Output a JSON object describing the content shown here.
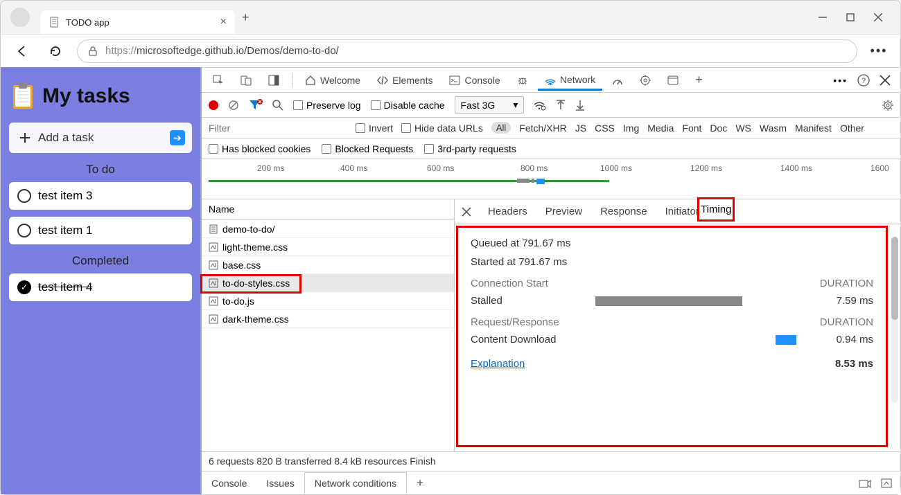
{
  "browser": {
    "tab_title": "TODO app",
    "url_proto": "https://",
    "url_rest": "microsoftedge.github.io/Demos/demo-to-do/"
  },
  "app": {
    "title": "My tasks",
    "add_label": "Add a task",
    "todo_label": "To do",
    "completed_label": "Completed",
    "todo_items": [
      "test item 3",
      "test item 1"
    ],
    "completed_items": [
      "test item 4"
    ]
  },
  "devtools": {
    "tabs": {
      "welcome": "Welcome",
      "elements": "Elements",
      "console": "Console",
      "network": "Network"
    },
    "toolbar": {
      "preserve_log": "Preserve log",
      "disable_cache": "Disable cache",
      "throttle": "Fast 3G"
    },
    "filter": {
      "placeholder": "Filter",
      "invert": "Invert",
      "hide_urls": "Hide data URLs",
      "types": [
        "All",
        "Fetch/XHR",
        "JS",
        "CSS",
        "Img",
        "Media",
        "Font",
        "Doc",
        "WS",
        "Wasm",
        "Manifest",
        "Other"
      ],
      "blocked_cookies": "Has blocked cookies",
      "blocked_requests": "Blocked Requests",
      "third_party": "3rd-party requests"
    },
    "timeline_ticks": [
      "200 ms",
      "400 ms",
      "600 ms",
      "800 ms",
      "1000 ms",
      "1200 ms",
      "1400 ms",
      "1600"
    ],
    "requests": {
      "header": "Name",
      "rows": [
        {
          "name": "demo-to-do/",
          "type": "doc"
        },
        {
          "name": "light-theme.css",
          "type": "css"
        },
        {
          "name": "base.css",
          "type": "css"
        },
        {
          "name": "to-do-styles.css",
          "type": "css",
          "selected": true
        },
        {
          "name": "to-do.js",
          "type": "css"
        },
        {
          "name": "dark-theme.css",
          "type": "css"
        }
      ]
    },
    "detail_tabs": [
      "Headers",
      "Preview",
      "Response",
      "Initiator",
      "Timing"
    ],
    "timing": {
      "queued": "Queued at 791.67 ms",
      "started": "Started at 791.67 ms",
      "conn_start": "Connection Start",
      "duration": "DURATION",
      "stalled": "Stalled",
      "stalled_val": "7.59 ms",
      "req_resp": "Request/Response",
      "content_dl": "Content Download",
      "content_dl_val": "0.94 ms",
      "explanation": "Explanation",
      "total": "8.53 ms"
    },
    "status": "6 requests  820 B transferred  8.4 kB resources  Finish",
    "drawer": {
      "console": "Console",
      "issues": "Issues",
      "netcond": "Network conditions"
    }
  }
}
